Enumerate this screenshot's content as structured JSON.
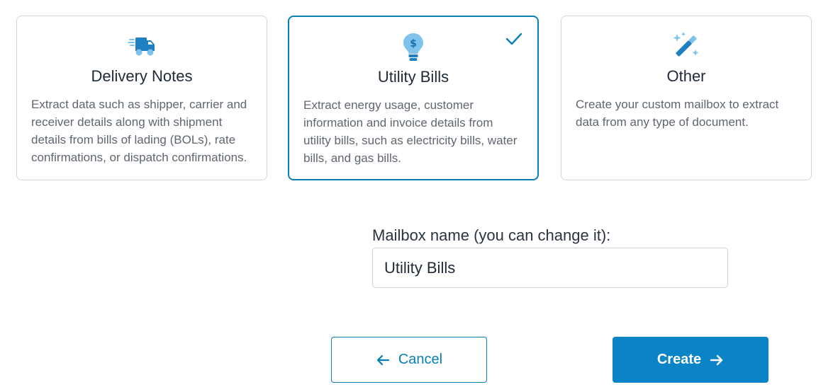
{
  "cards": [
    {
      "title": "Delivery Notes",
      "description": "Extract data such as shipper, carrier and receiver details along with shipment details from bills of lading (BOLs), rate confirmations, or dispatch confirmations.",
      "icon": "delivery-truck-icon",
      "selected": false
    },
    {
      "title": "Utility Bills",
      "description": "Extract energy usage, customer information and invoice details from utility bills, such as electricity bills, water bills, and gas bills.",
      "icon": "lightbulb-dollar-icon",
      "selected": true
    },
    {
      "title": "Other",
      "description": "Create your custom mailbox to extract data from any type of document.",
      "icon": "magic-wand-icon",
      "selected": false
    }
  ],
  "mailbox": {
    "label": "Mailbox name (you can change it):",
    "value": "Utility Bills"
  },
  "actions": {
    "cancel_label": "Cancel",
    "create_label": "Create"
  },
  "colors": {
    "accent": "#0a84c6",
    "accent_border": "#0a7fb5",
    "icon_blue": "#1e7fc1",
    "icon_light": "#7fc3ec"
  }
}
